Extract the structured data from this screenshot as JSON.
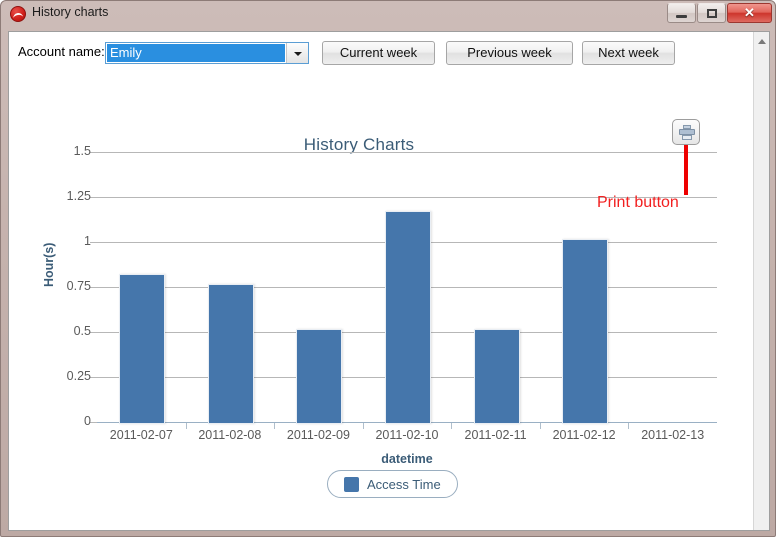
{
  "window": {
    "title": "History charts",
    "icon": "wave-circle-icon",
    "controls": {
      "minimize": "minimize-icon",
      "maximize": "maximize-icon",
      "close": "✕"
    }
  },
  "toolbar": {
    "account_label": "Account name:",
    "account_value": "Emily",
    "account_options": [
      "Emily"
    ],
    "current_week_label": "Current week",
    "previous_week_label": "Previous week",
    "next_week_label": "Next week"
  },
  "annotation": {
    "print_button_label": "Print button",
    "print_button_icon": "printer-icon",
    "color": "#f22020"
  },
  "chart_data": {
    "type": "bar",
    "title": "History Charts",
    "xlabel": "datetime",
    "ylabel": "Hour(s)",
    "categories": [
      "2011-02-07",
      "2011-02-08",
      "2011-02-09",
      "2011-02-10",
      "2011-02-11",
      "2011-02-12",
      "2011-02-13"
    ],
    "series": [
      {
        "name": "Access Time",
        "color": "#4576ab",
        "values": [
          0.82,
          0.765,
          0.515,
          1.17,
          0.515,
          1.015,
          0
        ]
      }
    ],
    "ylim": [
      0,
      1.5
    ],
    "yticks": [
      0,
      0.25,
      0.5,
      0.75,
      1,
      1.25,
      1.5
    ],
    "ytick_labels": [
      "0",
      "0.25",
      "0.5",
      "0.75",
      "1",
      "1.25",
      "1.5"
    ],
    "grid": true,
    "legend_position": "bottom-center",
    "legend": [
      "Access Time"
    ]
  }
}
